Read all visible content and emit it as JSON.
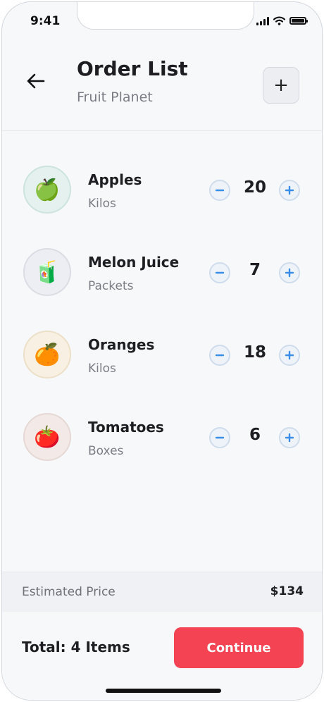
{
  "status_bar": {
    "time": "9:41"
  },
  "header": {
    "title": "Order List",
    "subtitle": "Fruit Planet",
    "add_label": "+"
  },
  "items": [
    {
      "name": "Apples",
      "unit": "Kilos",
      "quantity": "20",
      "icon": "green-apple-icon",
      "avatar_bg": "#e4f1ef",
      "avatar_border": "#cde3df",
      "emoji": "🍏"
    },
    {
      "name": "Melon Juice",
      "unit": "Packets",
      "quantity": "7",
      "icon": "juice-box-icon",
      "avatar_bg": "#eceef3",
      "avatar_border": "#dadde3",
      "emoji": "🧃"
    },
    {
      "name": "Oranges",
      "unit": "Kilos",
      "quantity": "18",
      "icon": "orange-icon",
      "avatar_bg": "#f8f0e2",
      "avatar_border": "#ede0c8",
      "emoji": "🍊"
    },
    {
      "name": "Tomatoes",
      "unit": "Boxes",
      "quantity": "6",
      "icon": "tomato-icon",
      "avatar_bg": "#f3e9e7",
      "avatar_border": "#e6d8d5",
      "emoji": "🍅"
    }
  ],
  "summary": {
    "price_label": "Estimated Price",
    "price_value": "$134"
  },
  "footer": {
    "total": "Total: 4 Items",
    "continue_label": "Continue"
  },
  "colors": {
    "accent": "#f44352",
    "stepper_icon": "#3a8ee8"
  }
}
